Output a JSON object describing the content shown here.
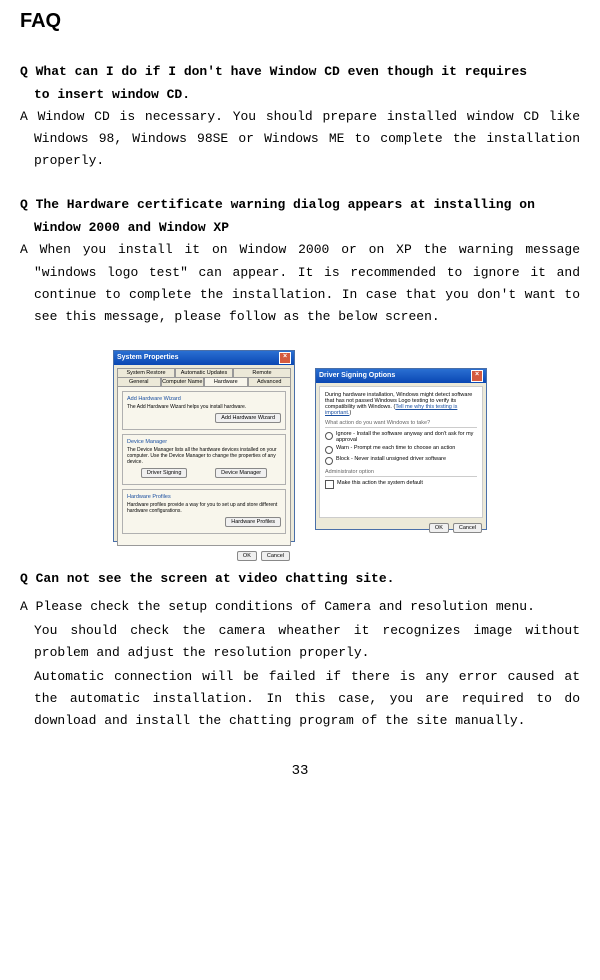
{
  "title": "FAQ",
  "q1": "Q What can I do if I don't have Window CD even though it requires",
  "q1b": "to insert window CD.",
  "a1": "A Window CD is necessary. You should prepare installed window CD like Windows 98, Windows 98SE or Windows ME to complete the installation properly.",
  "q2": "Q The Hardware certificate warning dialog appears at installing on",
  "q2b": "Window 2000 and Window XP",
  "a2": "A When you install it on Window 2000 or on XP the warning message \"windows logo test\" can appear. It is recommended to ignore it and continue to complete the installation. In case that you don't want to see this message, please follow as the below screen.",
  "fig1": {
    "winTitle": "System Properties",
    "tabs": {
      "a": "System Restore",
      "b": "Automatic Updates",
      "c": "Remote",
      "d": "General",
      "e": "Computer Name",
      "f": "Hardware",
      "g": "Advanced"
    },
    "addHwTitle": "Add Hardware Wizard",
    "addHwText": "The Add Hardware Wizard helps you install hardware.",
    "addHwBtn": "Add Hardware Wizard",
    "devMgrTitle": "Device Manager",
    "devMgrText": "The Device Manager lists all the hardware devices installed on your computer. Use the Device Manager to change the properties of any device.",
    "drvSignBtn": "Driver Signing",
    "devMgrBtn": "Device Manager",
    "hwProfTitle": "Hardware Profiles",
    "hwProfText": "Hardware profiles provide a way for you to set up and store different hardware configurations.",
    "hwProfBtn": "Hardware Profiles",
    "ok": "OK",
    "cancel": "Cancel"
  },
  "fig2": {
    "winTitle": "Driver Signing Options",
    "intro": "During hardware installation, Windows might detect software that has not passed Windows Logo testing to verify its compatibility with Windows.",
    "link": "Tell me why this testing is important.",
    "whatAction": "What action do you want Windows to take?",
    "opt1": "Ignore - Install the software anyway and don't ask for my approval",
    "opt2": "Warn - Prompt me each time to choose an action",
    "opt3": "Block - Never install unsigned driver software",
    "adminTitle": "Administrator option",
    "adminChk": "Make this action the system default",
    "ok": "OK",
    "cancel": "Cancel"
  },
  "q3": "Q Can not see the screen at video chatting site.",
  "a3a": "A Please check the setup conditions of Camera and resolution menu.",
  "a3b": "You should check the camera wheather it recognizes image without problem and adjust the resolution properly.",
  "a3c": "Automatic connection will be failed if there is any error caused at the automatic installation. In this case, you are required to do download and install the chatting program of the site manually.",
  "pagenum": "33"
}
